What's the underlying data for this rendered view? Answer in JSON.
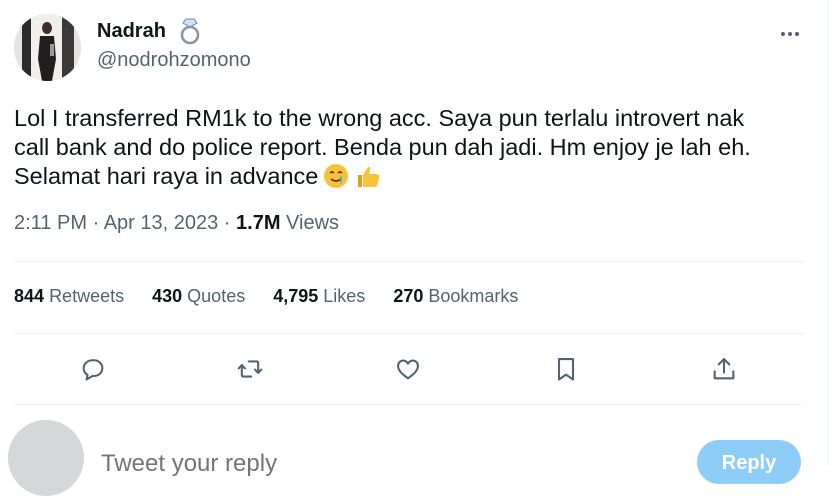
{
  "author": {
    "display_name": "Nadrah",
    "handle": "@nodrohzomono"
  },
  "tweet": {
    "lines": [
      "Lol I transferred RM1k to the wrong acc. Saya pun terlalu introvert nak",
      "call bank and do police report. Benda pun dah jadi. Hm enjoy je lah eh.",
      "Selamat hari raya in advance"
    ],
    "emojis": [
      "crying-smile-icon",
      "thumbs-up-icon"
    ]
  },
  "meta": {
    "time": "2:11 PM",
    "separator": "·",
    "date": "Apr 13, 2023",
    "views_count": "1.7M",
    "views_label": "Views"
  },
  "stats": [
    {
      "count": "844",
      "label": "Retweets"
    },
    {
      "count": "430",
      "label": "Quotes"
    },
    {
      "count": "4,795",
      "label": "Likes"
    },
    {
      "count": "270",
      "label": "Bookmarks"
    }
  ],
  "actions": [
    "reply-icon",
    "retweet-icon",
    "like-icon",
    "bookmark-icon",
    "share-icon"
  ],
  "reply_box": {
    "placeholder": "Tweet your reply",
    "button_label": "Reply"
  },
  "colors": {
    "text": "#0f1419",
    "secondary": "#536471",
    "divider": "#eff3f4",
    "reply_button": "#8ecdf8"
  }
}
